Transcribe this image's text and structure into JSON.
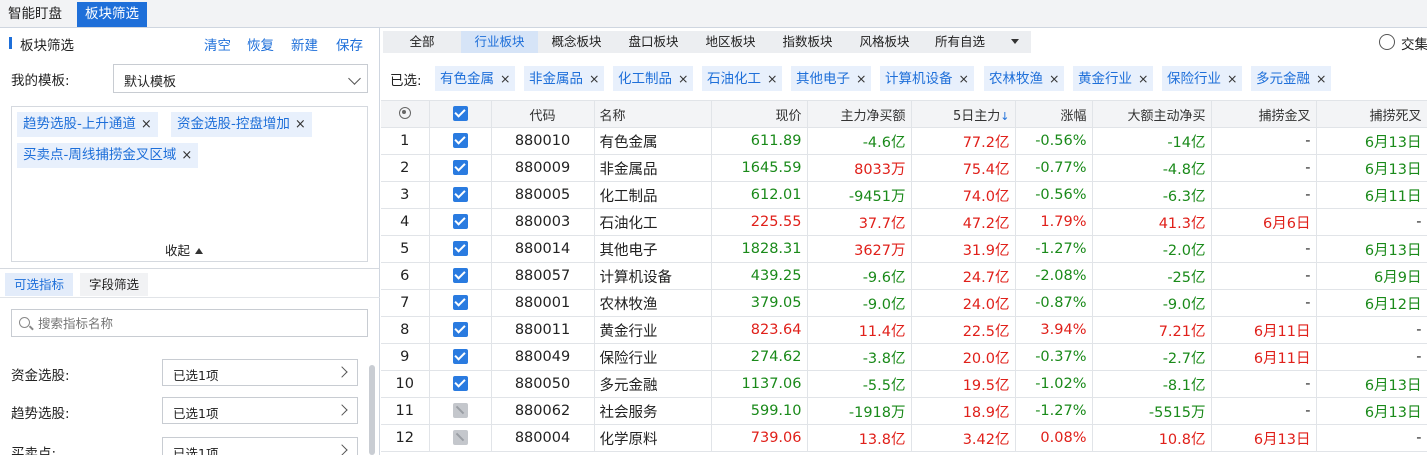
{
  "top_tabs": [
    "智能盯盘",
    "板块筛选"
  ],
  "left": {
    "title": "板块筛选",
    "actions": [
      "清空",
      "恢复",
      "新建",
      "保存"
    ],
    "template_label": "我的模板:",
    "template_value": "默认模板",
    "tags": [
      "趋势选股-上升通道",
      "资金选股-控盘增加",
      "买卖点-周线捕捞金叉区域"
    ],
    "collapse_label": "收起",
    "sub_tabs": [
      "可选指标",
      "字段筛选"
    ],
    "search_placeholder": "搜索指标名称",
    "filters": [
      {
        "label": "资金选股:",
        "value": "已选1项"
      },
      {
        "label": "趋势选股:",
        "value": "已选1项"
      },
      {
        "label": "买卖点:",
        "value": "已选1项"
      }
    ]
  },
  "right": {
    "category_tabs": [
      "全部",
      "行业板块",
      "概念板块",
      "盘口板块",
      "地区板块",
      "指数板块",
      "风格板块",
      "所有自选"
    ],
    "active_category": 1,
    "intersect_label": "交集",
    "selected_label": "已选:",
    "selected_tags": [
      "有色金属",
      "非金属品",
      "化工制品",
      "石油化工",
      "其他电子",
      "计算机设备",
      "农林牧渔",
      "黄金行业",
      "保险行业",
      "多元金融"
    ],
    "columns": [
      "",
      "",
      "代码",
      "名称",
      "现价",
      "主力净买额",
      "5日主力",
      "涨幅",
      "大额主动净买",
      "捕捞金叉",
      "捕捞死叉"
    ],
    "sort_arrow": "↓",
    "rows": [
      {
        "idx": "1",
        "checked": true,
        "code": "880010",
        "name": "有色金属",
        "price": "611.89",
        "net": "-4.6亿",
        "d5": "77.2亿",
        "chg": "-0.56%",
        "big": "-14亿",
        "gold": "-",
        "dead": "6月13日"
      },
      {
        "idx": "2",
        "checked": true,
        "code": "880009",
        "name": "非金属品",
        "price": "1645.59",
        "net": "8033万",
        "d5": "75.4亿",
        "chg": "-0.77%",
        "big": "-4.8亿",
        "gold": "-",
        "dead": "6月13日"
      },
      {
        "idx": "3",
        "checked": true,
        "code": "880005",
        "name": "化工制品",
        "price": "612.01",
        "net": "-9451万",
        "d5": "74.0亿",
        "chg": "-0.56%",
        "big": "-6.3亿",
        "gold": "-",
        "dead": "6月11日"
      },
      {
        "idx": "4",
        "checked": true,
        "code": "880003",
        "name": "石油化工",
        "price": "225.55",
        "net": "37.7亿",
        "d5": "47.2亿",
        "chg": "1.79%",
        "big": "41.3亿",
        "gold": "6月6日",
        "dead": "-"
      },
      {
        "idx": "5",
        "checked": true,
        "code": "880014",
        "name": "其他电子",
        "price": "1828.31",
        "net": "3627万",
        "d5": "31.9亿",
        "chg": "-1.27%",
        "big": "-2.0亿",
        "gold": "-",
        "dead": "6月13日"
      },
      {
        "idx": "6",
        "checked": true,
        "code": "880057",
        "name": "计算机设备",
        "price": "439.25",
        "net": "-9.6亿",
        "d5": "24.7亿",
        "chg": "-2.08%",
        "big": "-25亿",
        "gold": "-",
        "dead": "6月9日"
      },
      {
        "idx": "7",
        "checked": true,
        "code": "880001",
        "name": "农林牧渔",
        "price": "379.05",
        "net": "-9.0亿",
        "d5": "24.0亿",
        "chg": "-0.87%",
        "big": "-9.0亿",
        "gold": "-",
        "dead": "6月12日"
      },
      {
        "idx": "8",
        "checked": true,
        "code": "880011",
        "name": "黄金行业",
        "price": "823.64",
        "net": "11.4亿",
        "d5": "22.5亿",
        "chg": "3.94%",
        "big": "7.21亿",
        "gold": "6月11日",
        "dead": "-"
      },
      {
        "idx": "9",
        "checked": true,
        "code": "880049",
        "name": "保险行业",
        "price": "274.62",
        "net": "-3.8亿",
        "d5": "20.0亿",
        "chg": "-0.37%",
        "big": "-2.7亿",
        "gold": "6月11日",
        "dead": "-"
      },
      {
        "idx": "10",
        "checked": true,
        "code": "880050",
        "name": "多元金融",
        "price": "1137.06",
        "net": "-5.5亿",
        "d5": "19.5亿",
        "chg": "-1.02%",
        "big": "-8.1亿",
        "gold": "-",
        "dead": "6月13日"
      },
      {
        "idx": "11",
        "checked": false,
        "code": "880062",
        "name": "社会服务",
        "price": "599.10",
        "net": "-1918万",
        "d5": "18.9亿",
        "chg": "-1.27%",
        "big": "-5515万",
        "gold": "-",
        "dead": "6月13日"
      },
      {
        "idx": "12",
        "checked": false,
        "code": "880004",
        "name": "化学原料",
        "price": "739.06",
        "net": "13.8亿",
        "d5": "3.42亿",
        "chg": "0.08%",
        "big": "10.8亿",
        "gold": "6月13日",
        "dead": "-"
      }
    ]
  },
  "colors": {
    "accent": "#1e6fd9",
    "up": "#e0201a",
    "down": "#1a8a1a"
  }
}
